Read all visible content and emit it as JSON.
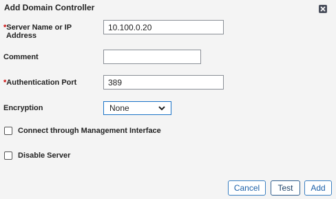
{
  "dialog": {
    "title": "Add Domain Controller",
    "close_icon": "close-icon"
  },
  "form": {
    "server": {
      "required_mark": "*",
      "label_line1": "Server Name or IP",
      "label_line2": "Address",
      "value": "10.100.0.20"
    },
    "comment": {
      "label": "Comment",
      "value": ""
    },
    "auth_port": {
      "required_mark": "*",
      "label": "Authentication Port",
      "value": "389"
    },
    "encryption": {
      "label": "Encryption",
      "selected": "None"
    },
    "mgmt_interface": {
      "label": "Connect through Management Interface",
      "checked": false
    },
    "disable_server": {
      "label": "Disable Server",
      "checked": false
    }
  },
  "buttons": {
    "cancel": "Cancel",
    "test": "Test",
    "add": "Add"
  },
  "colors": {
    "required": "#cc0000",
    "button_text": "#1a5fa8",
    "select_border": "#1a73c7"
  }
}
